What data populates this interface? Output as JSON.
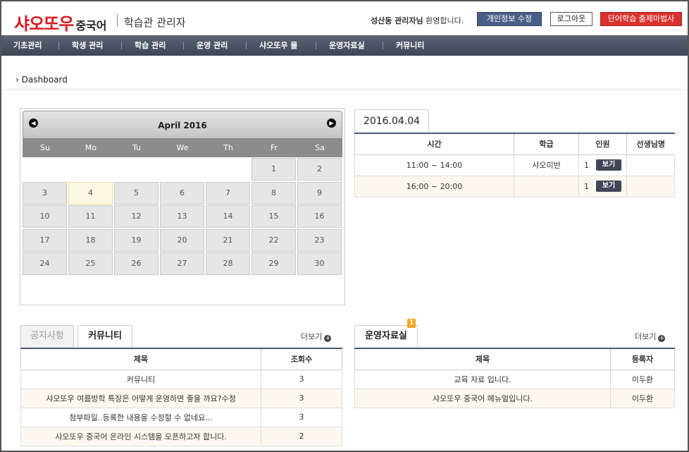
{
  "header": {
    "brand": "샤오또우",
    "brand_sub": "중국어",
    "site_title": "학습관 관리자",
    "welcome_user": "성산동 관리자님",
    "welcome_suffix": " 환영합니다.",
    "btn_profile": "개인정보 수정",
    "btn_logout": "로그아웃",
    "btn_study": "단어학습 출제마법사"
  },
  "nav": [
    "기초관리",
    "학생 관리",
    "학습 관리",
    "운영 관리",
    "샤오또우 몰",
    "운영자료실",
    "커뮤니티"
  ],
  "breadcrumb": "Dashboard",
  "calendar": {
    "title": "April 2016",
    "prev": "◀",
    "next": "▶",
    "weekdays": [
      "Su",
      "Mo",
      "Tu",
      "We",
      "Th",
      "Fr",
      "Sa"
    ],
    "days": [
      "1",
      "2",
      "3",
      "4",
      "5",
      "6",
      "7",
      "8",
      "9",
      "10",
      "11",
      "12",
      "13",
      "14",
      "15",
      "16",
      "17",
      "18",
      "19",
      "20",
      "21",
      "22",
      "23",
      "24",
      "25",
      "26",
      "27",
      "28",
      "29",
      "30"
    ],
    "today": "4"
  },
  "schedule": {
    "date": "2016.04.04",
    "headers": [
      "시간",
      "학급",
      "인원",
      "선생님명"
    ],
    "view_label": "보기",
    "rows": [
      {
        "time": "11:00 ~ 14:00",
        "class": "샤오미반",
        "count": "1",
        "teacher": ""
      },
      {
        "time": "16:00 ~ 20:00",
        "class": "",
        "count": "1",
        "teacher": ""
      }
    ]
  },
  "community": {
    "tab_notice": "공지사항",
    "tab_community": "커뮤니티",
    "more": "더보기",
    "headers": [
      "제목",
      "조회수"
    ],
    "rows": [
      {
        "title": "커뮤니티",
        "views": "3"
      },
      {
        "title": "샤오또우 여름방학 특장은 어떻게 운영하면 좋을 까요?수정",
        "views": "3"
      },
      {
        "title": "첨부파일..등록한 내용을 수정할 수 없네요...",
        "views": "3"
      },
      {
        "title": "샤오또우 중국어 온라인 시스템을 오픈하고자 합니다.",
        "views": "2"
      }
    ]
  },
  "resources": {
    "tab": "운영자료실",
    "badge": "1",
    "more": "더보기",
    "headers": [
      "제목",
      "등록자"
    ],
    "rows": [
      {
        "title": "교육 자료 입니다.",
        "author": "이두환"
      },
      {
        "title": "샤오또우 중국어 메뉴얼입니다.",
        "author": "이두환"
      }
    ]
  },
  "colors": {
    "brand_red": "#d71920",
    "nav_bg": "#4a5262",
    "table_accent": "#4c5b75",
    "study_button": "#d9322d",
    "profile_button": "#4a5f86"
  }
}
